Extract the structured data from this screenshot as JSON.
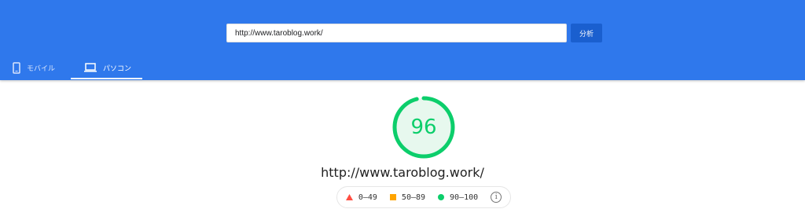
{
  "header": {
    "url_input_value": "http://www.taroblog.work/",
    "analyze_label": "分析",
    "background_color": "#2f78ec"
  },
  "tabs": [
    {
      "label": "モバイル",
      "icon": "smartphone-icon",
      "selected": false
    },
    {
      "label": "パソコン",
      "icon": "laptop-icon",
      "selected": true
    }
  ],
  "report": {
    "score": "96",
    "score_fraction": 0.96,
    "score_color": "#0cce6b",
    "url": "http://www.taroblog.work/"
  },
  "legend": {
    "items": [
      {
        "label": "0–49",
        "marker": "triangle",
        "color": "#ff4e42"
      },
      {
        "label": "50–89",
        "marker": "square",
        "color": "#ffa400"
      },
      {
        "label": "90–100",
        "marker": "circle",
        "color": "#0cce6b"
      }
    ],
    "info_icon": "info-icon"
  }
}
